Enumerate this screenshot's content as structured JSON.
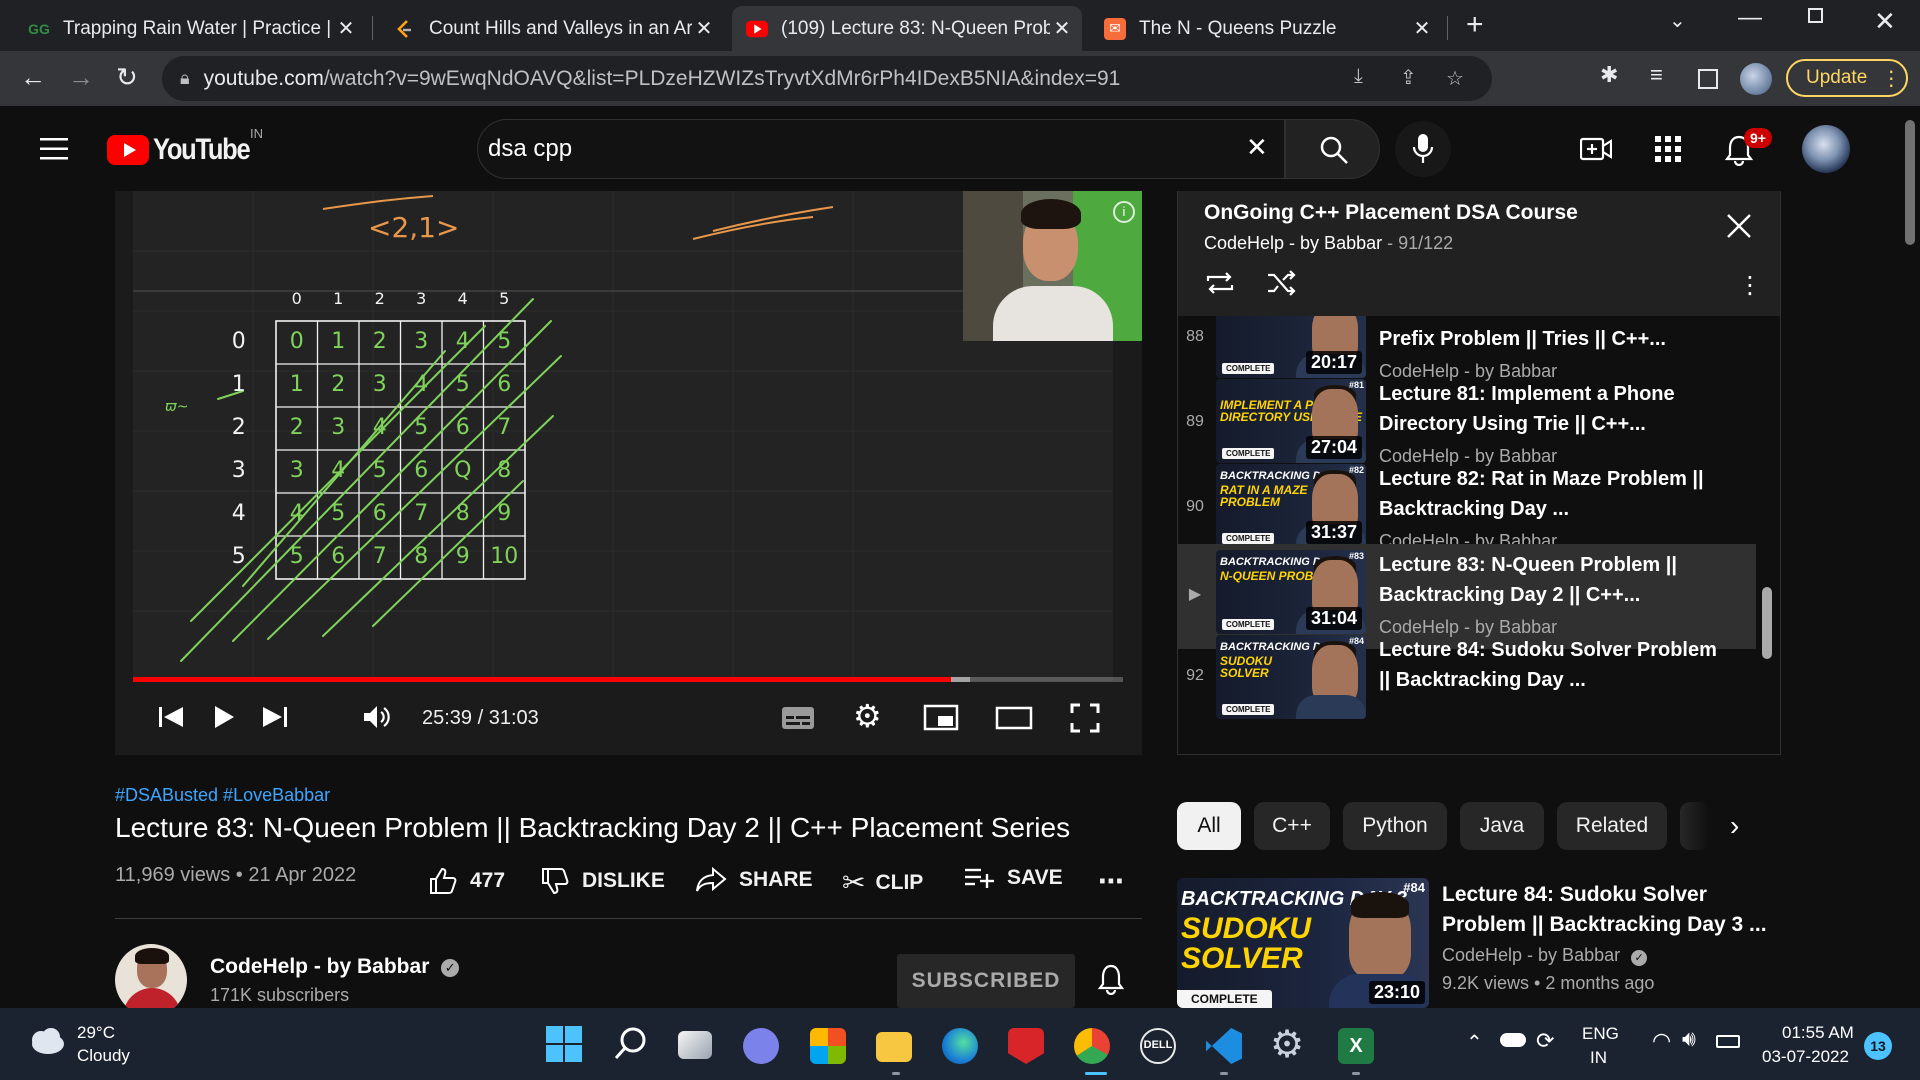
{
  "browser": {
    "tabs": [
      {
        "title": "Trapping Rain Water | Practice | G",
        "favicon": "gfg-icon",
        "active": false
      },
      {
        "title": "Count Hills and Valleys in an Arra",
        "favicon": "leetcode-icon",
        "active": false
      },
      {
        "title": "(109) Lecture 83: N-Queen Proble",
        "favicon": "youtube-icon",
        "active": true
      },
      {
        "title": "The N - Queens Puzzle",
        "favicon": "codingninjas-icon",
        "active": false
      }
    ],
    "url_host": "youtube.com",
    "url_path": "/watch?v=9wEwqNdOAVQ&list=PLDzeHZWIZsTryvtXdMr6rPh4IDexB5NIA&index=91",
    "update_label": "Update"
  },
  "youtube": {
    "logo_text": "YouTube",
    "region": "IN",
    "search_value": "dsa cpp",
    "notification_count": "9+"
  },
  "player": {
    "current_time": "25:39",
    "duration": "31:03",
    "time_display": "25:39 / 31:03",
    "progress_fraction": 0.826,
    "buffered_fraction": 0.845,
    "board": {
      "col_headers": [
        "0",
        "1",
        "2",
        "3",
        "4",
        "5"
      ],
      "row_headers": [
        "0",
        "1",
        "2",
        "3",
        "4",
        "5"
      ],
      "grid": [
        [
          "0",
          "1",
          "2",
          "3",
          "4",
          "5"
        ],
        [
          "1",
          "2",
          "3",
          "4",
          "5",
          "6"
        ],
        [
          "2",
          "3",
          "4",
          "5",
          "6",
          "7"
        ],
        [
          "3",
          "4",
          "5",
          "6",
          "Q",
          "8"
        ],
        [
          "4",
          "5",
          "6",
          "7",
          "8",
          "9"
        ],
        [
          "5",
          "6",
          "7",
          "8",
          "9",
          "10"
        ]
      ],
      "top_note": "<2,1>"
    }
  },
  "video": {
    "hashtags": "#DSABusted #LoveBabbar",
    "title": "Lecture 83: N-Queen Problem || Backtracking Day 2 || C++ Placement Series",
    "meta": "11,969 views • 21 Apr 2022",
    "likes": "477",
    "dislike_label": "DISLIKE",
    "share_label": "SHARE",
    "clip_label": "CLIP",
    "save_label": "SAVE",
    "channel_name": "CodeHelp - by Babbar",
    "subscribers": "171K subscribers",
    "subscribed_label": "SUBSCRIBED"
  },
  "playlist": {
    "title": "OnGoing C++ Placement DSA Course",
    "channel": "CodeHelp - by Babbar",
    "position": "91/122",
    "items": [
      {
        "index": "88",
        "title": "Prefix Problem || Tries || C++...",
        "channel": "CodeHelp - by Babbar",
        "duration": "20:17",
        "thumb_l1": "",
        "thumb_l2": "",
        "thumb_l3": "",
        "tag": ""
      },
      {
        "index": "89",
        "title": "Lecture 81: Implement a Phone Directory Using Trie || C++...",
        "channel": "CodeHelp - by Babbar",
        "duration": "27:04",
        "thumb_l1": "",
        "thumb_l2": "IMPLEMENT A PHONE",
        "thumb_l3": "DIRECTORY USING TRIE",
        "tag": "#81"
      },
      {
        "index": "90",
        "title": "Lecture 82: Rat in Maze Problem || Backtracking Day ...",
        "channel": "CodeHelp - by Babbar",
        "duration": "31:37",
        "thumb_l1": "BACKTRACKING DAY 1",
        "thumb_l2": "RAT IN A MAZE",
        "thumb_l3": "PROBLEM",
        "tag": "#82"
      },
      {
        "index": "",
        "title": "Lecture 83: N-Queen Problem || Backtracking Day 2 || C++...",
        "channel": "CodeHelp - by Babbar",
        "duration": "31:04",
        "thumb_l1": "BACKTRACKING DAY2",
        "thumb_l2": "N-QUEEN PROBLEM",
        "thumb_l3": "",
        "tag": "#83"
      },
      {
        "index": "92",
        "title": "Lecture 84: Sudoku Solver Problem || Backtracking Day ...",
        "channel": "CodeHelp - by Babbar",
        "duration": "",
        "thumb_l1": "BACKTRACKING DAY 3",
        "thumb_l2": "SUDOKU",
        "thumb_l3": "SOLVER",
        "tag": "#84"
      }
    ],
    "thumb_badge": "COMPLETE"
  },
  "chips": [
    "All",
    "C++",
    "Python",
    "Java",
    "Related"
  ],
  "related": {
    "title": "Lecture 84: Sudoku Solver Problem || Backtracking Day 3 ...",
    "channel": "CodeHelp - by Babbar",
    "meta": "9.2K views • 2 months ago",
    "duration": "23:10",
    "thumb_l1": "BACKTRACKING DAY 3",
    "thumb_l2": "SUDOKU",
    "thumb_l3": "SOLVER",
    "tag": "#84",
    "badge": "COMPLETE"
  },
  "taskbar": {
    "temperature": "29°C",
    "weather": "Cloudy",
    "lang1": "ENG",
    "lang2": "IN",
    "time": "01:55 AM",
    "date": "03-07-2022",
    "notif_count": "13"
  },
  "colors": {
    "youtube_red": "#ff0000",
    "link_blue": "#3ea6ff",
    "update_yellow": "#fdd663",
    "chalk_green": "#7fd35a",
    "chalk_orange": "#e8974a"
  }
}
